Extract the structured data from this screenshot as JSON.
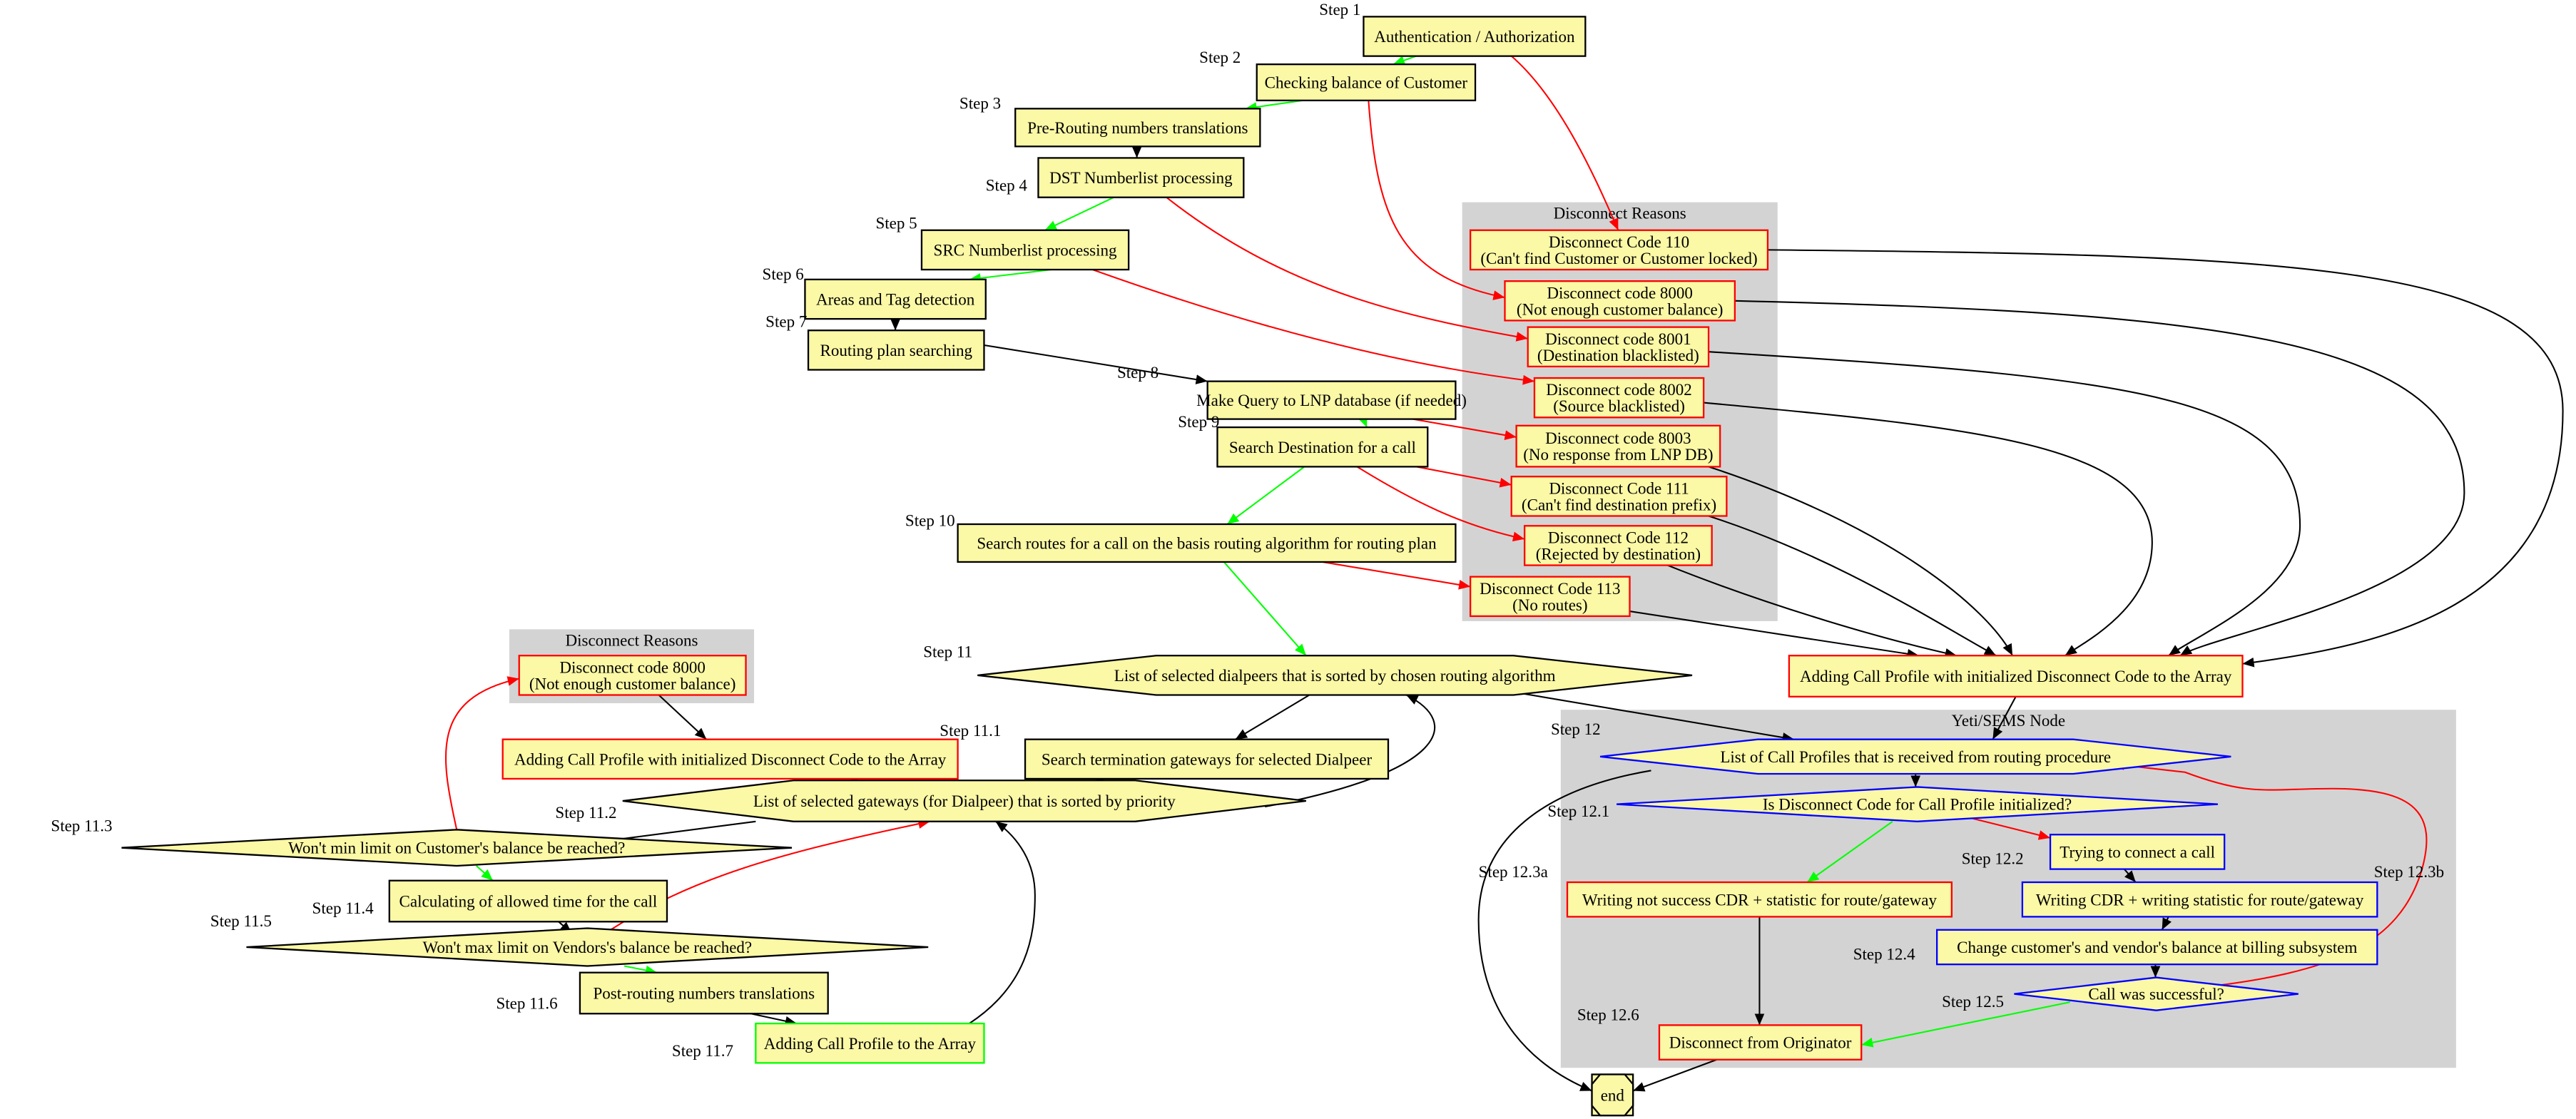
{
  "colors": {
    "node_fill": "#fbf8a6",
    "cluster_fill": "#d3d3d3",
    "green": "#00ff00",
    "red": "#ff0000",
    "blue": "#0000ff",
    "black": "#000000"
  },
  "clusters": {
    "disconnect_reasons_main": "Disconnect Reasons",
    "disconnect_reasons_small": "Disconnect Reasons",
    "yeti_sems_node": "Yeti/SEMS Node"
  },
  "nodes": {
    "auth": {
      "step": "Step 1",
      "label": [
        "Authentication / Authorization"
      ]
    },
    "balance": {
      "step": "Step 2",
      "label": [
        "Checking balance of Customer"
      ]
    },
    "prerouting": {
      "step": "Step 3",
      "label": [
        "Pre-Routing numbers translations"
      ]
    },
    "dst": {
      "step": "Step 4",
      "label": [
        "DST Numberlist processing"
      ]
    },
    "src": {
      "step": "Step 5",
      "label": [
        "SRC Numberlist processing"
      ]
    },
    "areas": {
      "step": "Step 6",
      "label": [
        "Areas and Tag detection"
      ]
    },
    "routingplan": {
      "step": "Step 7",
      "label": [
        "Routing plan searching"
      ]
    },
    "lnp": {
      "step": "Step 8",
      "label": [
        "Make Query to LNP database (if needed)"
      ]
    },
    "searchdst": {
      "step": "Step 9",
      "label": [
        "Search Destination for a call"
      ]
    },
    "searchroutes": {
      "step": "Step 10",
      "label": [
        "Search routes for a call on the basis routing algorithm for routing plan"
      ]
    },
    "dc110": {
      "label": [
        "Disconnect Code 110",
        "(Can't find Customer or Customer locked)"
      ]
    },
    "dc8000": {
      "label": [
        "Disconnect code 8000",
        "(Not enough customer balance)"
      ]
    },
    "dc8001": {
      "label": [
        "Disconnect code 8001",
        "(Destination blacklisted)"
      ]
    },
    "dc8002": {
      "label": [
        "Disconnect code 8002",
        "(Source blacklisted)"
      ]
    },
    "dc8003": {
      "label": [
        "Disconnect code 8003",
        "(No response from LNP DB)"
      ]
    },
    "dc111": {
      "label": [
        "Disconnect Code 111",
        "(Can't find destination prefix)"
      ]
    },
    "dc112": {
      "label": [
        "Disconnect Code 112",
        "(Rejected by destination)"
      ]
    },
    "dc113": {
      "label": [
        "Disconnect Code 113",
        "(No routes)"
      ]
    },
    "addingdc": {
      "label": [
        "Adding Call Profile with initialized Disconnect Code to the Array"
      ]
    },
    "dialpeers": {
      "step": "Step 11",
      "label": [
        "List of selected dialpeers that is sorted by chosen routing algorithm"
      ]
    },
    "dc8000b": {
      "label": [
        "Disconnect code 8000",
        "(Not enough customer balance)"
      ]
    },
    "addingdc2": {
      "step": "Step 11.1",
      "label": [
        "Adding Call Profile with initialized Disconnect Code to the Array"
      ]
    },
    "searchterm": {
      "label": [
        "Search termination gateways for selected Dialpeer"
      ]
    },
    "gateways": {
      "step": "Step 11.2",
      "label": [
        "List of selected gateways (for Dialpeer) that is sorted by priority"
      ]
    },
    "minlimit": {
      "step": "Step 11.3",
      "label": [
        "Won't min limit on Customer's balance be reached?"
      ]
    },
    "calctime": {
      "step": "Step 11.4",
      "label": [
        "Calculating of allowed time for the call"
      ]
    },
    "maxlimit": {
      "step": "Step 11.5",
      "label": [
        "Won't max limit on Vendors's balance be reached?"
      ]
    },
    "postrouting": {
      "step": "Step 11.6",
      "label": [
        "Post-routing numbers translations"
      ]
    },
    "addprofile": {
      "step": "Step 11.7",
      "label": [
        "Adding Call Profile to the Array"
      ]
    },
    "callprofiles": {
      "step": "Step 12",
      "label": [
        "List of Call Profiles that is received from routing procedure"
      ]
    },
    "initialized": {
      "step": "Step 12.1",
      "label": [
        "Is Disconnect Code for Call Profile initialized?"
      ]
    },
    "trying": {
      "step": "Step 12.2",
      "label": [
        "Trying to connect a call"
      ]
    },
    "notsuccess": {
      "step": "Step 12.3a",
      "label": [
        "Writing not success CDR + statistic for route/gateway"
      ]
    },
    "writecdr": {
      "step": "Step 12.3b",
      "label": [
        "Writing CDR + writing statistic for route/gateway"
      ]
    },
    "changebalance": {
      "step": "Step 12.4",
      "label": [
        "Change customer's and vendor's balance at billing subsystem"
      ]
    },
    "successful": {
      "step": "Step 12.5",
      "label": [
        "Call was successful?"
      ]
    },
    "disconnect": {
      "step": "Step 12.6",
      "label": [
        "Disconnect from Originator"
      ]
    },
    "end": {
      "label": [
        "end"
      ]
    }
  }
}
